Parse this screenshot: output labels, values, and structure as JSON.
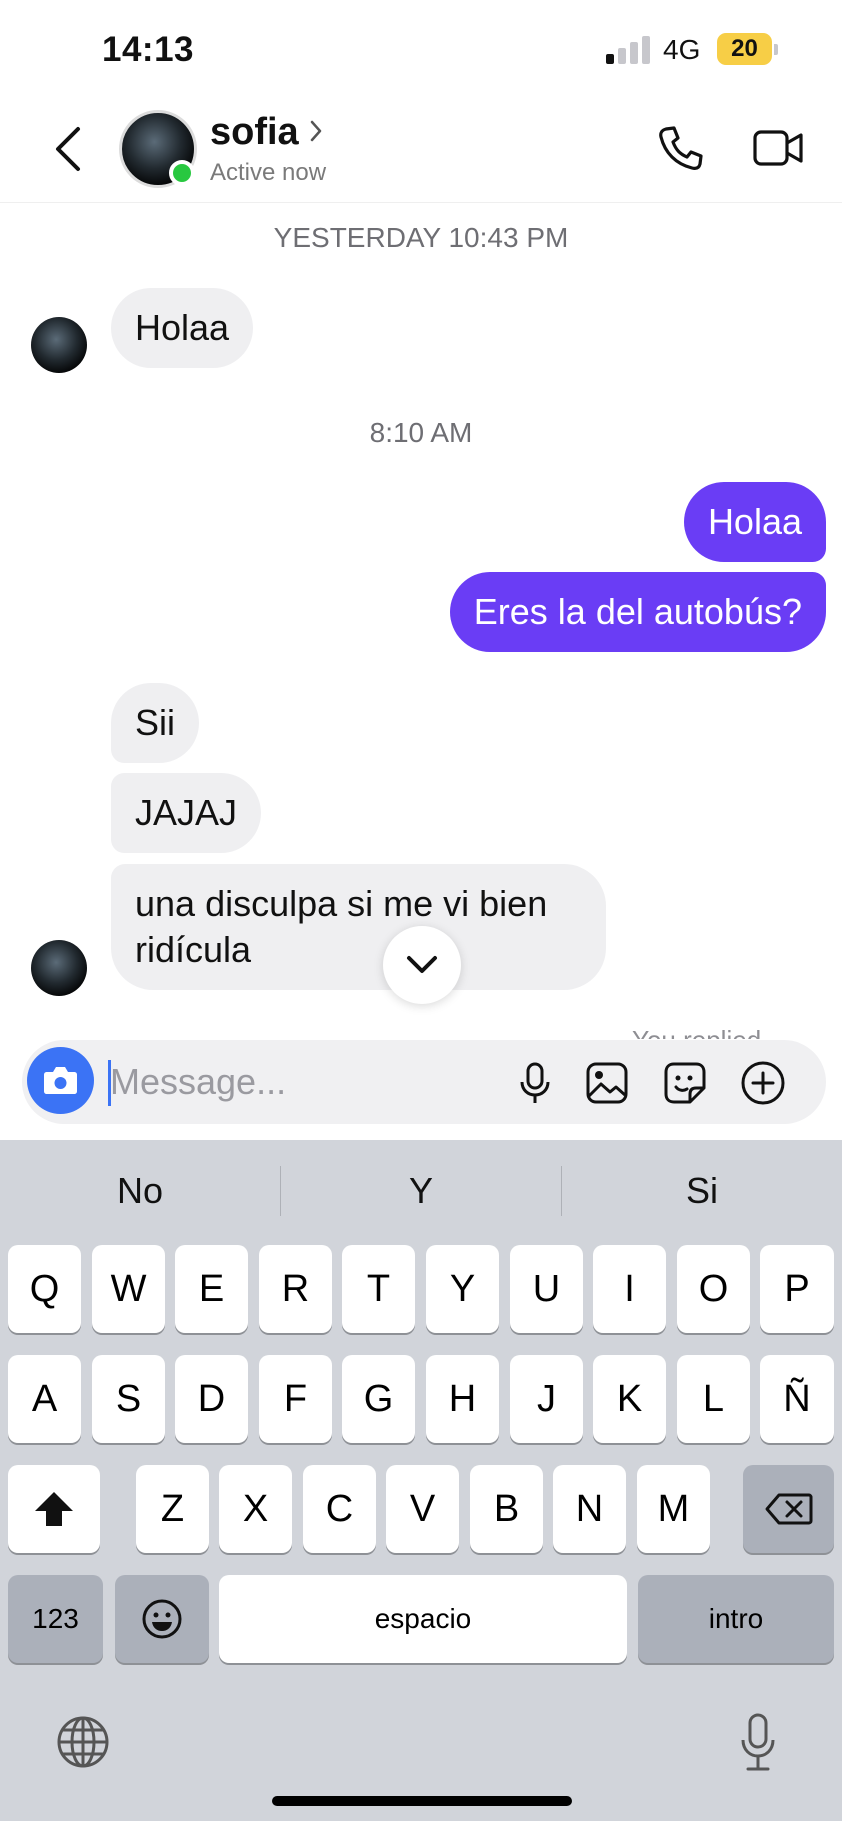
{
  "status_bar": {
    "time": "14:13",
    "network": "4G",
    "battery": "20"
  },
  "header": {
    "contact_name": "sofia",
    "presence": "Active now"
  },
  "messages": {
    "day_stamp": "YESTERDAY 10:43 PM",
    "msg1": "Holaa",
    "time_stamp": "8:10 AM",
    "out1": "Holaa",
    "out2": "Eres la del autobús?",
    "in2": "Sii",
    "in3": "JAJAJ",
    "in4_line1": "una disculpa si me vi bien",
    "in4_line2": "ridícula",
    "peek": "You replied"
  },
  "composer": {
    "placeholder": "Message..."
  },
  "keyboard": {
    "suggestions": [
      "No",
      "Y",
      "Si"
    ],
    "row1": [
      "Q",
      "W",
      "E",
      "R",
      "T",
      "Y",
      "U",
      "I",
      "O",
      "P"
    ],
    "row2": [
      "A",
      "S",
      "D",
      "F",
      "G",
      "H",
      "J",
      "K",
      "L",
      "Ñ"
    ],
    "row3": [
      "Z",
      "X",
      "C",
      "V",
      "B",
      "N",
      "M"
    ],
    "numbers": "123",
    "space": "espacio",
    "return": "intro"
  },
  "colors": {
    "outgoing": "#6a3df5",
    "incoming": "#efeff1",
    "online": "#28c840",
    "camera": "#3b73f5"
  }
}
